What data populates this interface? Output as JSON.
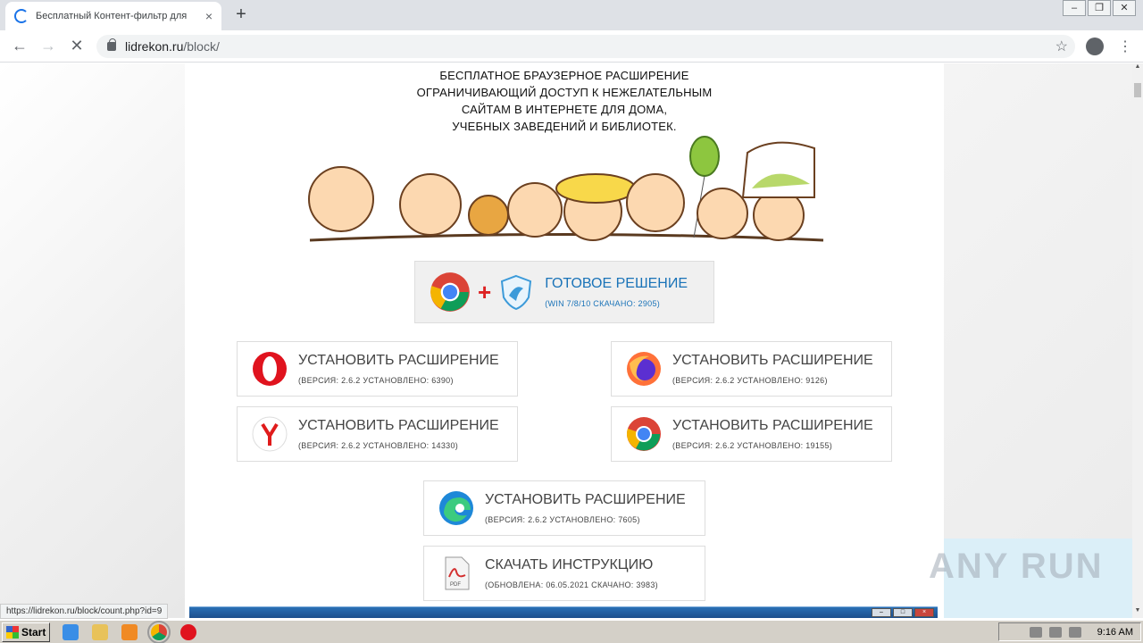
{
  "browser": {
    "tab_title": "Бесплатный Контент-фильтр для",
    "tab_close": "×",
    "new_tab": "+",
    "url_host": "lidrekon.ru",
    "url_path": "/block/",
    "status_link": "https://lidrekon.ru/block/count.php?id=9"
  },
  "page": {
    "headline": [
      "БЕСПЛАТНОЕ БРАУЗЕРНОЕ РАСШИРЕНИЕ",
      "ОГРАНИЧИВАЮЩИЙ ДОСТУП К НЕЖЕЛАТЕЛЬНЫМ",
      "САЙТАМ В ИНТЕРНЕТЕ ДЛЯ ДОМА,",
      "УЧЕБНЫХ ЗАВЕДЕНИЙ И БИБЛИОТЕК."
    ],
    "ready": {
      "label": "ГОТОВОЕ РЕШЕНИЕ",
      "sub": "(WIN 7/8/10 СКАЧАНО: 2905)"
    },
    "buttons": [
      {
        "label": "УСТАНОВИТЬ РАСШИРЕНИЕ",
        "sub": "(ВЕРСИЯ: 2.6.2 УСТАНОВЛЕНО: 6390)",
        "icon": "opera-icon"
      },
      {
        "label": "УСТАНОВИТЬ РАСШИРЕНИЕ",
        "sub": "(ВЕРСИЯ: 2.6.2 УСТАНОВЛЕНО: 9126)",
        "icon": "firefox-icon"
      },
      {
        "label": "УСТАНОВИТЬ РАСШИРЕНИЕ",
        "sub": "(ВЕРСИЯ: 2.6.2 УСТАНОВЛЕНО: 14330)",
        "icon": "yandex-icon"
      },
      {
        "label": "УСТАНОВИТЬ РАСШИРЕНИЕ",
        "sub": "(ВЕРСИЯ: 2.6.2 УСТАНОВЛЕНО: 19155)",
        "icon": "chrome-icon"
      },
      {
        "label": "УСТАНОВИТЬ РАСШИРЕНИЕ",
        "sub": "(ВЕРСИЯ: 2.6.2 УСТАНОВЛЕНО: 7605)",
        "icon": "edge-icon"
      },
      {
        "label": "СКАЧАТЬ ИНСТРУКЦИЮ",
        "sub": "(ОБНОВЛЕНА: 06.05.2021 СКАЧАНО: 3983)",
        "icon": "pdf-icon"
      }
    ]
  },
  "watermark": "ANY RUN",
  "taskbar": {
    "start_label": "Start",
    "clock": "9:16 AM"
  }
}
